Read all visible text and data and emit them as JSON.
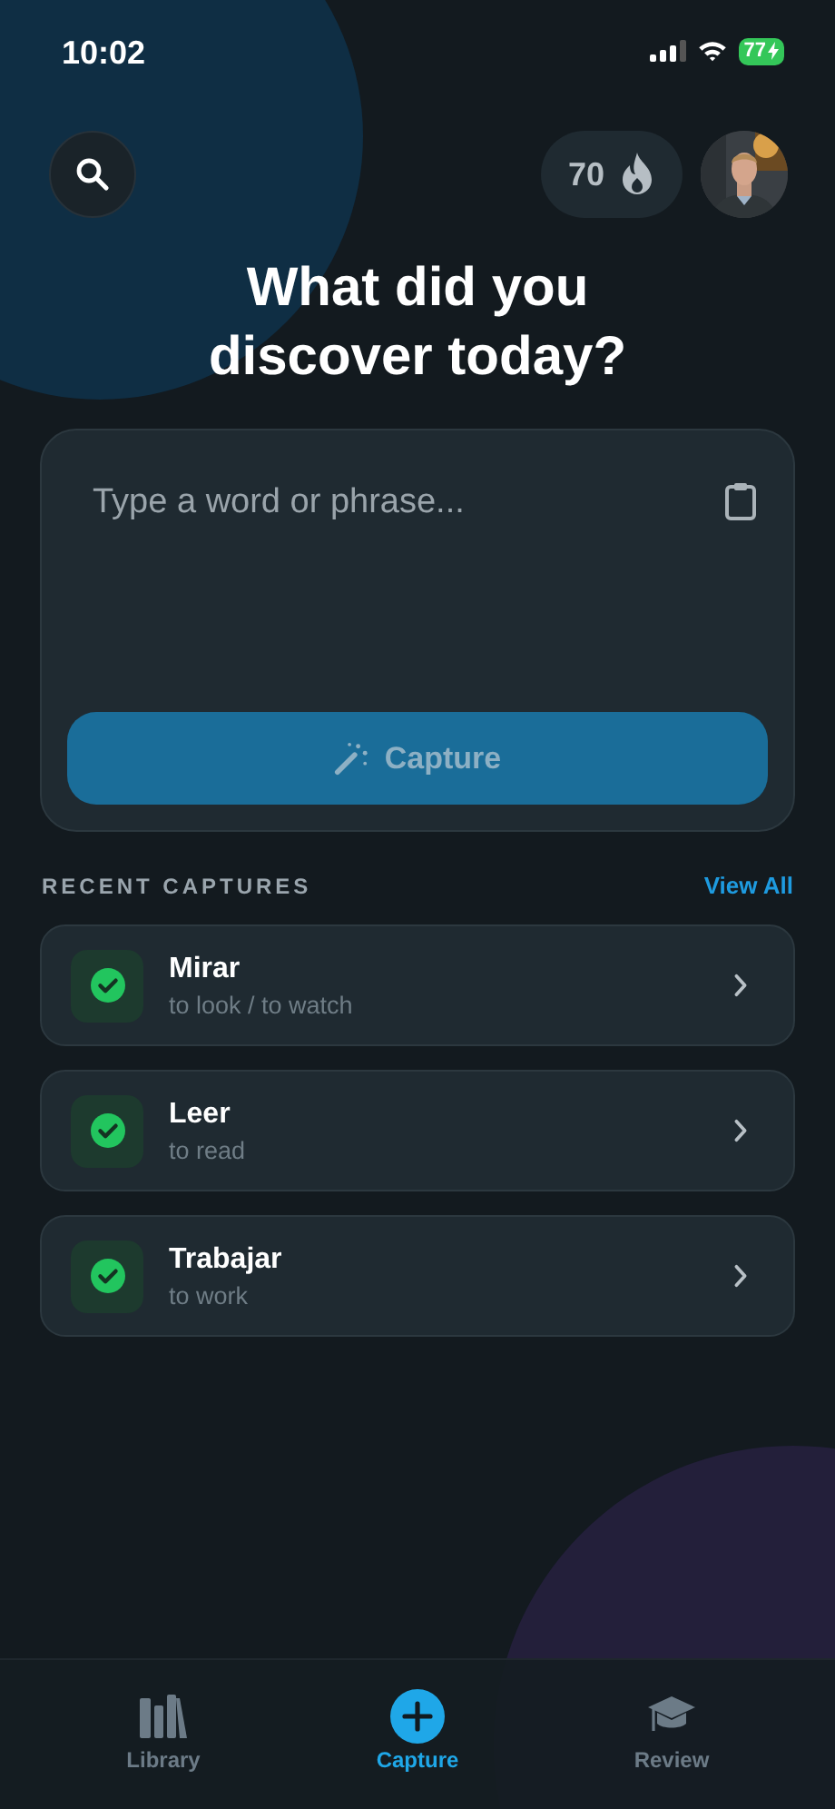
{
  "status_bar": {
    "time": "10:02",
    "battery": "77"
  },
  "header": {
    "streak": "70"
  },
  "title": "What did you discover today?",
  "capture_card": {
    "placeholder": "Type a word or phrase...",
    "button": {
      "label": "Capture",
      "disabled": true
    }
  },
  "recent": {
    "heading": "RECENT CAPTURES",
    "link": "View All",
    "items": [
      {
        "word": "Mirar",
        "meaning": "to look / to watch",
        "done": true
      },
      {
        "word": "Leer",
        "meaning": "to read",
        "done": true
      },
      {
        "word": "Trabajar",
        "meaning": "to work",
        "done": true
      }
    ]
  },
  "tab_bar": [
    {
      "kind": "library",
      "label": "Library",
      "selected": false
    },
    {
      "kind": "capture",
      "label": "Capture",
      "selected": true
    },
    {
      "kind": "review",
      "label": "Review",
      "selected": false
    }
  ]
}
